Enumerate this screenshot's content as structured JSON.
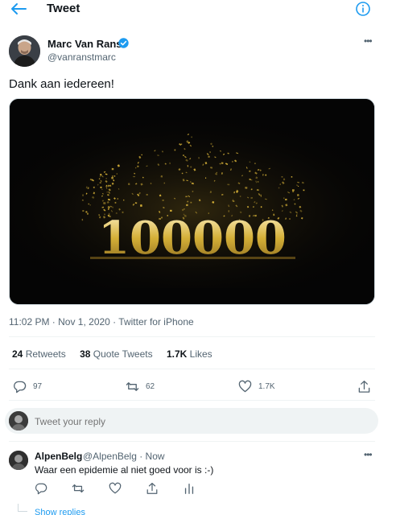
{
  "header": {
    "title": "Tweet",
    "back_icon": "arrow-left-icon",
    "info_icon": "info-icon",
    "accent": "#1d9bf0"
  },
  "tweet": {
    "author_name": "Marc Van Ranst",
    "author_handle": "@vanranstmarc",
    "verified": true,
    "more_label": "•••",
    "text": "Dank aan iedereen!",
    "media": {
      "image_text": "100000",
      "background": "#000000",
      "accent": "#d4af37"
    },
    "meta": "11:02 PM · Nov 1, 2020 · Twitter for iPhone",
    "stats": {
      "retweets_count": "24",
      "retweets_label": "Retweets",
      "quotes_count": "38",
      "quotes_label": "Quote Tweets",
      "likes_count": "1.7K",
      "likes_label": "Likes"
    },
    "actions": {
      "replies": "97",
      "retweets": "62",
      "likes": "1.7K"
    }
  },
  "reply_box": {
    "placeholder": "Tweet your reply"
  },
  "reply": {
    "author_name": "AlpenBelg",
    "author_handle": "@AlpenBelg · Now",
    "more_label": "•••",
    "text": "Waar een epidemie al niet goed voor is :-)",
    "show_replies": "Show replies"
  }
}
